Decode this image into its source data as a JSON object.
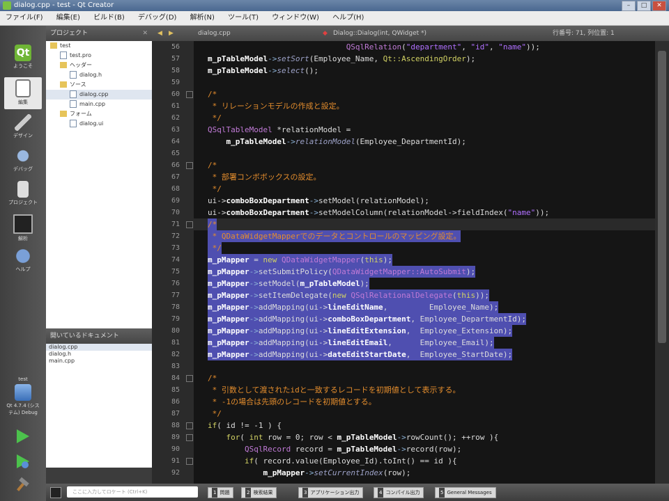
{
  "window": {
    "title": "dialog.cpp - test - Qt Creator",
    "minimize": "–",
    "maximize": "□",
    "close": "✕"
  },
  "menubar": [
    "ファイル(F)",
    "編集(E)",
    "ビルド(B)",
    "デバッグ(D)",
    "解析(N)",
    "ツール(T)",
    "ウィンドウ(W)",
    "ヘルプ(H)"
  ],
  "modes": [
    {
      "label": "ようこそ",
      "icon": "qt-logo-icon"
    },
    {
      "label": "編集",
      "icon": "edit-document-icon"
    },
    {
      "label": "デザイン",
      "icon": "design-pen-icon"
    },
    {
      "label": "デバッグ",
      "icon": "debug-bug-icon"
    },
    {
      "label": "プロジェクト",
      "icon": "project-icon"
    },
    {
      "label": "解析",
      "icon": "analyze-monitor-icon"
    },
    {
      "label": "ヘルプ",
      "icon": "help-globe-icon"
    }
  ],
  "target": {
    "project": "test",
    "label": "Qt 4.7.4 (システム) Debug"
  },
  "project_panel": {
    "title": "プロジェクト",
    "tree": [
      {
        "label": "test",
        "depth": 0,
        "kind": "project"
      },
      {
        "label": "test.pro",
        "depth": 1,
        "kind": "file"
      },
      {
        "label": "ヘッダー",
        "depth": 1,
        "kind": "folder"
      },
      {
        "label": "dialog.h",
        "depth": 2,
        "kind": "file"
      },
      {
        "label": "ソース",
        "depth": 1,
        "kind": "folder"
      },
      {
        "label": "dialog.cpp",
        "depth": 2,
        "kind": "file",
        "selected": true
      },
      {
        "label": "main.cpp",
        "depth": 2,
        "kind": "file"
      },
      {
        "label": "フォーム",
        "depth": 1,
        "kind": "folder"
      },
      {
        "label": "dialog.ui",
        "depth": 2,
        "kind": "file"
      }
    ]
  },
  "open_docs": {
    "title": "開いているドキュメント",
    "items": [
      "dialog.cpp",
      "dialog.h",
      "main.cpp"
    ]
  },
  "editor": {
    "file": "dialog.cpp",
    "symbol": "Dialog::Dialog(int, QWidget *)",
    "position": "行番号: 71, 列位置: 1"
  },
  "code_lines": [
    {
      "n": "56",
      "parts": [
        [
          "tx",
          "                              "
        ],
        [
          "ty",
          "QSqlRelation"
        ],
        [
          "tx",
          "("
        ],
        [
          "st",
          "\"department\""
        ],
        [
          "tx",
          ", "
        ],
        [
          "st",
          "\"id\""
        ],
        [
          "tx",
          ", "
        ],
        [
          "st",
          "\"name\""
        ],
        [
          "tx",
          "));"
        ]
      ]
    },
    {
      "n": "57",
      "parts": [
        [
          "id",
          "m_pTableModel"
        ],
        [
          "op",
          "->"
        ],
        [
          "it",
          "setSort"
        ],
        [
          "tx",
          "(Employee_Name, "
        ],
        [
          "kw",
          "Qt::AscendingOrder"
        ],
        [
          "tx",
          ");"
        ]
      ]
    },
    {
      "n": "58",
      "parts": [
        [
          "id",
          "m_pTableModel"
        ],
        [
          "op",
          "->"
        ],
        [
          "it",
          "select"
        ],
        [
          "tx",
          "();"
        ]
      ]
    },
    {
      "n": "59",
      "parts": []
    },
    {
      "n": "60",
      "fold": true,
      "parts": [
        [
          "cm",
          "/*"
        ]
      ]
    },
    {
      "n": "61",
      "parts": [
        [
          "cm",
          " * リレーションモデルの作成と設定。"
        ]
      ]
    },
    {
      "n": "62",
      "parts": [
        [
          "cm",
          " */"
        ]
      ]
    },
    {
      "n": "63",
      "parts": [
        [
          "ty",
          "QSqlTableModel"
        ],
        [
          "tx",
          " *relationModel ="
        ]
      ]
    },
    {
      "n": "64",
      "parts": [
        [
          "tx",
          "    "
        ],
        [
          "id",
          "m_pTableModel"
        ],
        [
          "op",
          "->"
        ],
        [
          "it",
          "relationModel"
        ],
        [
          "tx",
          "(Employee_DepartmentId);"
        ]
      ]
    },
    {
      "n": "65",
      "parts": []
    },
    {
      "n": "66",
      "fold": true,
      "parts": [
        [
          "cm",
          "/*"
        ]
      ]
    },
    {
      "n": "67",
      "parts": [
        [
          "cm",
          " * 部署コンボボックスの設定。"
        ]
      ]
    },
    {
      "n": "68",
      "parts": [
        [
          "cm",
          " */"
        ]
      ]
    },
    {
      "n": "69",
      "parts": [
        [
          "tx",
          "ui->"
        ],
        [
          "id",
          "comboBoxDepartment"
        ],
        [
          "op",
          "->"
        ],
        [
          "tx",
          "setModel(relationModel);"
        ]
      ]
    },
    {
      "n": "70",
      "parts": [
        [
          "tx",
          "ui->"
        ],
        [
          "id",
          "comboBoxDepartment"
        ],
        [
          "op",
          "->"
        ],
        [
          "tx",
          "setModelColumn(relationModel->fieldIndex("
        ],
        [
          "st",
          "\"name\""
        ],
        [
          "tx",
          "));"
        ]
      ]
    },
    {
      "n": "71",
      "fold": true,
      "current": true,
      "parts": [
        [
          "cm",
          "/*"
        ]
      ]
    },
    {
      "n": "72",
      "parts": [
        [
          "cm",
          " * QDataWidgetMapperでのデータとコントロールのマッピング設定。"
        ]
      ]
    },
    {
      "n": "73",
      "parts": [
        [
          "cm",
          " */"
        ]
      ]
    },
    {
      "n": "74",
      "parts": [
        [
          "id",
          "m_pMapper"
        ],
        [
          "tx",
          " = "
        ],
        [
          "kw",
          "new"
        ],
        [
          "tx",
          " "
        ],
        [
          "ty",
          "QDataWidgetMapper"
        ],
        [
          "tx",
          "("
        ],
        [
          "kw",
          "this"
        ],
        [
          "tx",
          ");"
        ]
      ]
    },
    {
      "n": "75",
      "parts": [
        [
          "id",
          "m_pMapper"
        ],
        [
          "op",
          "->"
        ],
        [
          "tx",
          "setSubmitPolicy("
        ],
        [
          "ty",
          "QDataWidgetMapper::AutoSubmit"
        ],
        [
          "tx",
          ");"
        ]
      ]
    },
    {
      "n": "76",
      "parts": [
        [
          "id",
          "m_pMapper"
        ],
        [
          "op",
          "->"
        ],
        [
          "tx",
          "setModel("
        ],
        [
          "id",
          "m_pTableModel"
        ],
        [
          "tx",
          ");"
        ]
      ]
    },
    {
      "n": "77",
      "parts": [
        [
          "id",
          "m_pMapper"
        ],
        [
          "op",
          "->"
        ],
        [
          "tx",
          "setItemDelegate("
        ],
        [
          "kw",
          "new"
        ],
        [
          "tx",
          " "
        ],
        [
          "ty",
          "QSqlRelationalDelegate"
        ],
        [
          "tx",
          "("
        ],
        [
          "kw",
          "this"
        ],
        [
          "tx",
          "));"
        ]
      ]
    },
    {
      "n": "78",
      "parts": [
        [
          "id",
          "m_pMapper"
        ],
        [
          "op",
          "->"
        ],
        [
          "tx",
          "addMapping(ui->"
        ],
        [
          "id",
          "lineEditName"
        ],
        [
          "tx",
          ",         Employee_Name);"
        ]
      ]
    },
    {
      "n": "79",
      "parts": [
        [
          "id",
          "m_pMapper"
        ],
        [
          "op",
          "->"
        ],
        [
          "tx",
          "addMapping(ui->"
        ],
        [
          "id",
          "comboBoxDepartment"
        ],
        [
          "tx",
          ", Employee_DepartmentId);"
        ]
      ]
    },
    {
      "n": "80",
      "parts": [
        [
          "id",
          "m_pMapper"
        ],
        [
          "op",
          "->"
        ],
        [
          "tx",
          "addMapping(ui->"
        ],
        [
          "id",
          "lineEditExtension"
        ],
        [
          "tx",
          ",  Employee_Extension);"
        ]
      ]
    },
    {
      "n": "81",
      "parts": [
        [
          "id",
          "m_pMapper"
        ],
        [
          "op",
          "->"
        ],
        [
          "tx",
          "addMapping(ui->"
        ],
        [
          "id",
          "lineEditEmail"
        ],
        [
          "tx",
          ",      Employee_Email);"
        ]
      ]
    },
    {
      "n": "82",
      "parts": [
        [
          "id",
          "m_pMapper"
        ],
        [
          "op",
          "->"
        ],
        [
          "tx",
          "addMapping(ui->"
        ],
        [
          "id",
          "dateEditStartDate"
        ],
        [
          "tx",
          ",  Employee_StartDate);"
        ]
      ]
    },
    {
      "n": "83",
      "parts": []
    },
    {
      "n": "84",
      "fold": true,
      "parts": [
        [
          "cm",
          "/*"
        ]
      ]
    },
    {
      "n": "85",
      "parts": [
        [
          "cm",
          " * 引数として渡されたidと一致するレコードを初期値として表示する。"
        ]
      ]
    },
    {
      "n": "86",
      "parts": [
        [
          "cm",
          " * -1の場合は先頭のレコードを初期値とする。"
        ]
      ]
    },
    {
      "n": "87",
      "parts": [
        [
          "cm",
          " */"
        ]
      ]
    },
    {
      "n": "88",
      "fold": true,
      "parts": [
        [
          "kw",
          "if"
        ],
        [
          "tx",
          "( id != -1 ) {"
        ]
      ]
    },
    {
      "n": "89",
      "fold": true,
      "parts": [
        [
          "tx",
          "    "
        ],
        [
          "kw",
          "for"
        ],
        [
          "tx",
          "( "
        ],
        [
          "kw",
          "int"
        ],
        [
          "tx",
          " row = 0; row < "
        ],
        [
          "id",
          "m_pTableModel"
        ],
        [
          "op",
          "->"
        ],
        [
          "tx",
          "rowCount(); ++row ){"
        ]
      ]
    },
    {
      "n": "90",
      "parts": [
        [
          "tx",
          "        "
        ],
        [
          "ty",
          "QSqlRecord"
        ],
        [
          "tx",
          " record = "
        ],
        [
          "id",
          "m_pTableModel"
        ],
        [
          "op",
          "->"
        ],
        [
          "tx",
          "record(row);"
        ]
      ]
    },
    {
      "n": "91",
      "fold": true,
      "parts": [
        [
          "tx",
          "        "
        ],
        [
          "kw",
          "if"
        ],
        [
          "tx",
          "( record.value(Employee_Id).toInt() == id ){"
        ]
      ]
    },
    {
      "n": "92",
      "parts": [
        [
          "tx",
          "            "
        ],
        [
          "id",
          "m_pMapper"
        ],
        [
          "op",
          "->"
        ],
        [
          "it",
          "setCurrentIndex"
        ],
        [
          "tx",
          "(row);"
        ]
      ]
    }
  ],
  "selection": {
    "from_line": "71",
    "to_line": "82"
  },
  "locator": {
    "placeholder": "ここに入力してロケート (Ctrl+K)"
  },
  "output_tabs": [
    {
      "num": "1",
      "label": "問題"
    },
    {
      "num": "2",
      "label": "検索結果"
    },
    {
      "num": "3",
      "label": "アプリケーション出力"
    },
    {
      "num": "4",
      "label": "コンパイル出力"
    },
    {
      "num": "5",
      "label": "General Messages"
    }
  ],
  "colors": {
    "selection": "#4f4fb0",
    "comment": "#e48d2d",
    "background": "#151515",
    "current_line": "#2a2a2a"
  }
}
